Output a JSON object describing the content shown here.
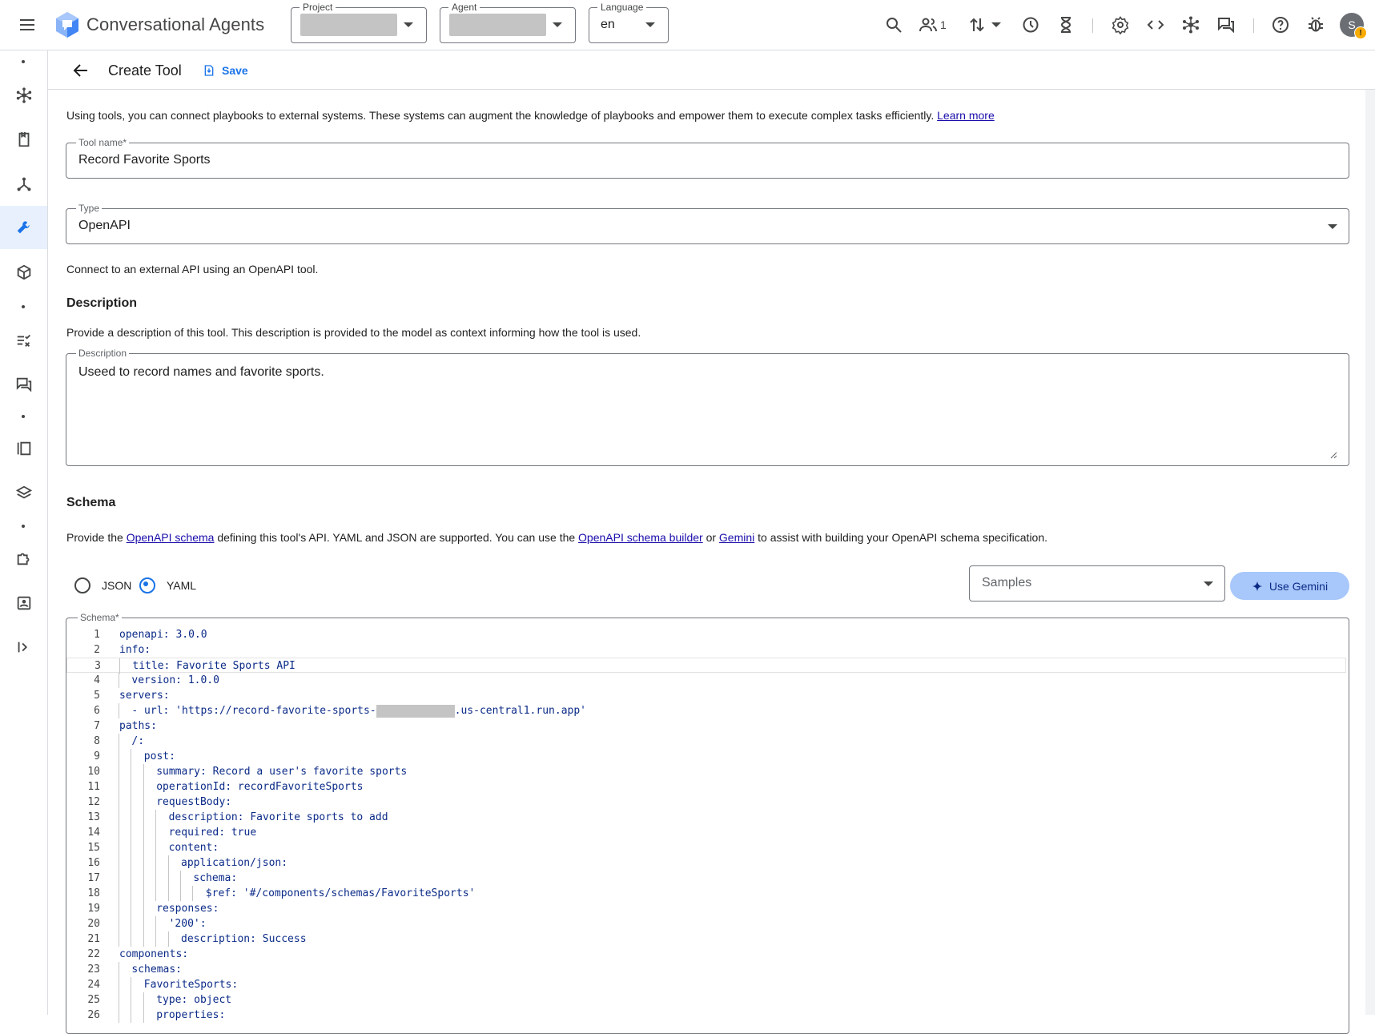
{
  "topbar": {
    "app_title": "Conversational Agents",
    "project_label": "Project",
    "agent_label": "Agent",
    "language_label": "Language",
    "language_value": "en",
    "users_count": "1",
    "avatar_initial": "S"
  },
  "subbar": {
    "title": "Create Tool",
    "save_label": "Save"
  },
  "main": {
    "intro_text": "Using tools, you can connect playbooks to external systems. These systems can augment the knowledge of playbooks and empower them to execute complex tasks efficiently.",
    "learn_more": "Learn more",
    "tool_name_label": "Tool name*",
    "tool_name_value": "Record Favorite Sports",
    "type_label": "Type",
    "type_value": "OpenAPI",
    "type_help": "Connect to an external API using an OpenAPI tool.",
    "description_heading": "Description",
    "description_help": "Provide a description of this tool. This description is provided to the model as context informing how the tool is used.",
    "description_label": "Description",
    "description_value": "Useed to record names and favorite sports.",
    "schema_heading": "Schema",
    "schema_help_1": "Provide the",
    "schema_link_1": "OpenAPI schema",
    "schema_help_2": "defining this tool's API. YAML and JSON are supported. You can use the",
    "schema_link_2": "OpenAPI schema builder",
    "schema_help_3": "or",
    "schema_link_3": "Gemini",
    "schema_help_4": "to assist with building your OpenAPI schema specification.",
    "radio_json": "JSON",
    "radio_yaml": "YAML",
    "samples_placeholder": "Samples",
    "use_gemini": "Use Gemini",
    "schema_label": "Schema*"
  },
  "code_lines": [
    {
      "n": "1",
      "indent": 0,
      "text": "openapi: 3.0.0"
    },
    {
      "n": "2",
      "indent": 0,
      "text": "info:"
    },
    {
      "n": "3",
      "indent": 1,
      "text": "title: Favorite Sports API"
    },
    {
      "n": "4",
      "indent": 1,
      "text": "version: 1.0.0"
    },
    {
      "n": "5",
      "indent": 0,
      "text": "servers:"
    },
    {
      "n": "6",
      "indent": 1,
      "text": "- url: 'https://record-favorite-sports-",
      "tail": ".us-central1.run.app'"
    },
    {
      "n": "7",
      "indent": 0,
      "text": "paths:"
    },
    {
      "n": "8",
      "indent": 1,
      "text": "/:"
    },
    {
      "n": "9",
      "indent": 2,
      "text": "post:"
    },
    {
      "n": "10",
      "indent": 3,
      "text": "summary: Record a user's favorite sports"
    },
    {
      "n": "11",
      "indent": 3,
      "text": "operationId: recordFavoriteSports"
    },
    {
      "n": "12",
      "indent": 3,
      "text": "requestBody:"
    },
    {
      "n": "13",
      "indent": 4,
      "text": "description: Favorite sports to add"
    },
    {
      "n": "14",
      "indent": 4,
      "text": "required: true"
    },
    {
      "n": "15",
      "indent": 4,
      "text": "content:"
    },
    {
      "n": "16",
      "indent": 5,
      "text": "application/json:"
    },
    {
      "n": "17",
      "indent": 6,
      "text": "schema:"
    },
    {
      "n": "18",
      "indent": 7,
      "text": "$ref: '#/components/schemas/FavoriteSports'"
    },
    {
      "n": "19",
      "indent": 3,
      "text": "responses:"
    },
    {
      "n": "20",
      "indent": 4,
      "text": "'200':"
    },
    {
      "n": "21",
      "indent": 5,
      "text": "description: Success"
    },
    {
      "n": "22",
      "indent": 0,
      "text": "components:"
    },
    {
      "n": "23",
      "indent": 1,
      "text": "schemas:"
    },
    {
      "n": "24",
      "indent": 2,
      "text": "FavoriteSports:"
    },
    {
      "n": "25",
      "indent": 3,
      "text": "type: object"
    },
    {
      "n": "26",
      "indent": 3,
      "text": "properties:"
    }
  ]
}
